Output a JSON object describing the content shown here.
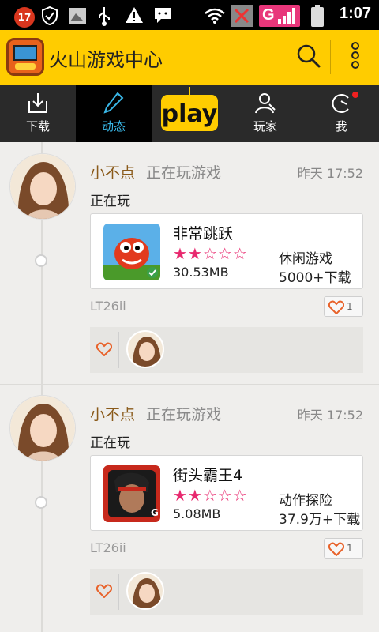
{
  "status_bar": {
    "notification_count": "17",
    "time": "1:07",
    "network": "G"
  },
  "app": {
    "title": "火山游戏中心"
  },
  "tabs": [
    {
      "label": "下载",
      "icon": "download-icon"
    },
    {
      "label": "动态",
      "icon": "pen-icon",
      "active": true
    },
    {
      "label": "play",
      "icon": "play-logo"
    },
    {
      "label": "玩家",
      "icon": "player-icon"
    },
    {
      "label": "我",
      "icon": "me-icon",
      "has_notification": true
    }
  ],
  "feed": [
    {
      "user": "小不点",
      "activity": "正在玩游戏",
      "time": "昨天 17:52",
      "status_text": "正在玩",
      "game": {
        "name": "非常跳跃",
        "rating": 2,
        "max_rating": 5,
        "stars": "★★☆☆☆",
        "size": "30.53MB",
        "category": "休闲游戏",
        "downloads": "5000+下载"
      },
      "device": "LT26ii",
      "likes": "1"
    },
    {
      "user": "小不点",
      "activity": "正在玩游戏",
      "time": "昨天 17:52",
      "status_text": "正在玩",
      "game": {
        "name": "街头霸王4",
        "rating": 2,
        "max_rating": 5,
        "stars": "★★☆☆☆",
        "size": "5.08MB",
        "category": "动作探险",
        "downloads": "37.9万+下载"
      },
      "device": "LT26ii",
      "likes": "1"
    }
  ],
  "colors": {
    "header": "#ffcc00",
    "tabbar": "#2a2a2a",
    "active_tab_text": "#39b6e6",
    "username": "#8a5a1a",
    "stars": "#e8286e",
    "heart": "#e8622a"
  }
}
